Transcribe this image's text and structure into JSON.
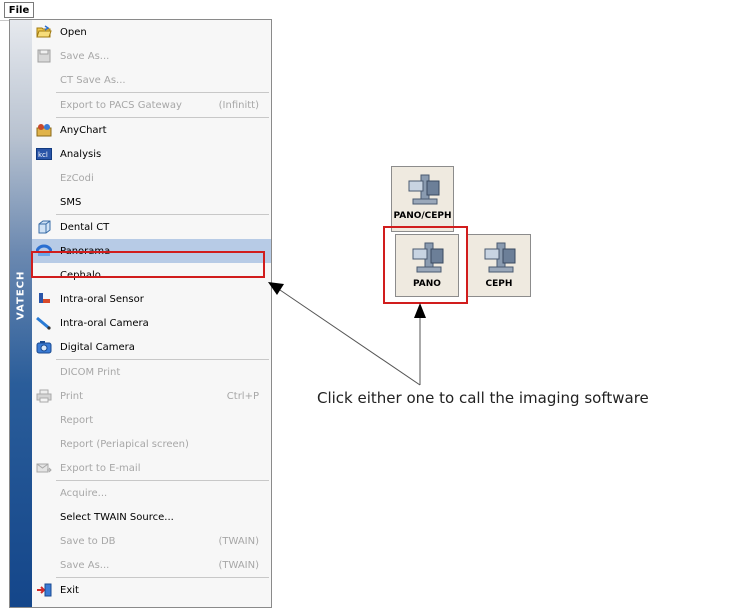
{
  "menubar": {
    "file_label": "File"
  },
  "menu": {
    "brand": "VATECH",
    "items": [
      {
        "label": "Open",
        "shortcut": "",
        "icon": "folder-open-icon",
        "disabled": false
      },
      {
        "label": "Save As...",
        "shortcut": "",
        "icon": "save-icon",
        "disabled": true
      },
      {
        "label": "CT Save As...",
        "shortcut": "",
        "icon": "",
        "disabled": true
      },
      {
        "label": "Export to PACS Gateway",
        "shortcut": "(Infinitt)",
        "icon": "",
        "disabled": true
      },
      {
        "label": "AnyChart",
        "shortcut": "",
        "icon": "anychart-icon",
        "disabled": false
      },
      {
        "label": "Analysis",
        "shortcut": "",
        "icon": "analysis-icon",
        "disabled": false
      },
      {
        "label": "EzCodi",
        "shortcut": "",
        "icon": "",
        "disabled": true
      },
      {
        "label": "SMS",
        "shortcut": "",
        "icon": "",
        "disabled": false
      },
      {
        "label": "Dental CT",
        "shortcut": "",
        "icon": "dental-ct-icon",
        "disabled": false
      },
      {
        "label": "Panorama",
        "shortcut": "",
        "icon": "panorama-icon",
        "disabled": false,
        "selected": true
      },
      {
        "label": "Cephalo",
        "shortcut": "",
        "icon": "",
        "disabled": false
      },
      {
        "label": "Intra-oral Sensor",
        "shortcut": "",
        "icon": "sensor-icon",
        "disabled": false
      },
      {
        "label": "Intra-oral Camera",
        "shortcut": "",
        "icon": "intraoral-camera-icon",
        "disabled": false
      },
      {
        "label": "Digital Camera",
        "shortcut": "",
        "icon": "digital-camera-icon",
        "disabled": false
      },
      {
        "label": "DICOM Print",
        "shortcut": "",
        "icon": "",
        "disabled": true
      },
      {
        "label": "Print",
        "shortcut": "Ctrl+P",
        "icon": "print-icon",
        "disabled": true
      },
      {
        "label": "Report",
        "shortcut": "",
        "icon": "",
        "disabled": true
      },
      {
        "label": "Report (Periapical screen)",
        "shortcut": "",
        "icon": "",
        "disabled": true
      },
      {
        "label": "Export to E-mail",
        "shortcut": "",
        "icon": "email-icon",
        "disabled": true
      },
      {
        "label": "Acquire...",
        "shortcut": "",
        "icon": "",
        "disabled": true
      },
      {
        "label": "Select TWAIN Source...",
        "shortcut": "",
        "icon": "",
        "disabled": false
      },
      {
        "label": "Save to DB",
        "shortcut": "(TWAIN)",
        "icon": "",
        "disabled": true
      },
      {
        "label": "Save As...",
        "shortcut": "(TWAIN)",
        "icon": "",
        "disabled": true
      },
      {
        "label": "Exit",
        "shortcut": "",
        "icon": "exit-icon",
        "disabled": false
      }
    ]
  },
  "toolbar": {
    "pano_ceph_label": "PANO/CEPH",
    "pano_label": "PANO",
    "ceph_label": "CEPH"
  },
  "caption": "Click either one to call the imaging software",
  "colors": {
    "highlight": "#d11d1d",
    "selected": "#b7cbe6",
    "sidebar": "#14468a"
  }
}
